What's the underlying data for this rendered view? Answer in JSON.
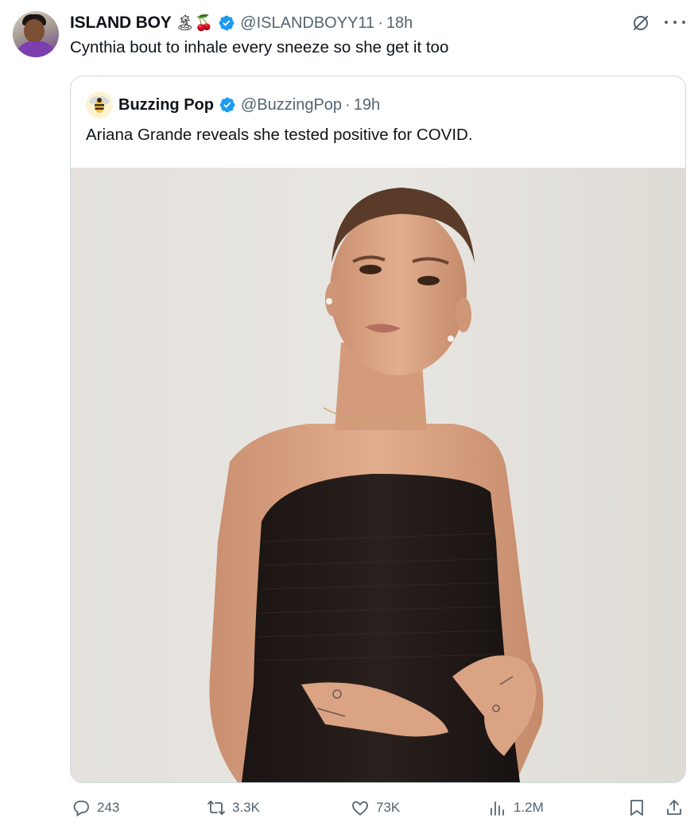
{
  "post": {
    "author": {
      "display_name": "ISLAND BOY",
      "emojis": "🏝🍒",
      "handle": "@ISLANDBOYY11",
      "separator": "·",
      "time": "18h",
      "verified": true
    },
    "text": "Cynthia bout to inhale every sneeze so she get it too",
    "quote": {
      "author": {
        "display_name": "Buzzing Pop",
        "handle": "@BuzzingPop",
        "separator": "·",
        "time": "19h",
        "verified": true
      },
      "text": "Ariana Grande reveals she tested positive for COVID."
    },
    "actions": {
      "replies": "243",
      "reposts": "3.3K",
      "likes": "73K",
      "views": "1.2M"
    }
  },
  "colors": {
    "verified": "#1d9bf0",
    "secondary_text": "#536471",
    "border": "#cfd9de",
    "dress": "#221a18",
    "skin": "#d9a384",
    "backdrop": "#e6e3de"
  },
  "icons": [
    "grok-icon",
    "more-icon",
    "verified-icon",
    "reply-icon",
    "repost-icon",
    "like-icon",
    "views-icon",
    "bookmark-icon",
    "share-icon",
    "bee-icon"
  ]
}
